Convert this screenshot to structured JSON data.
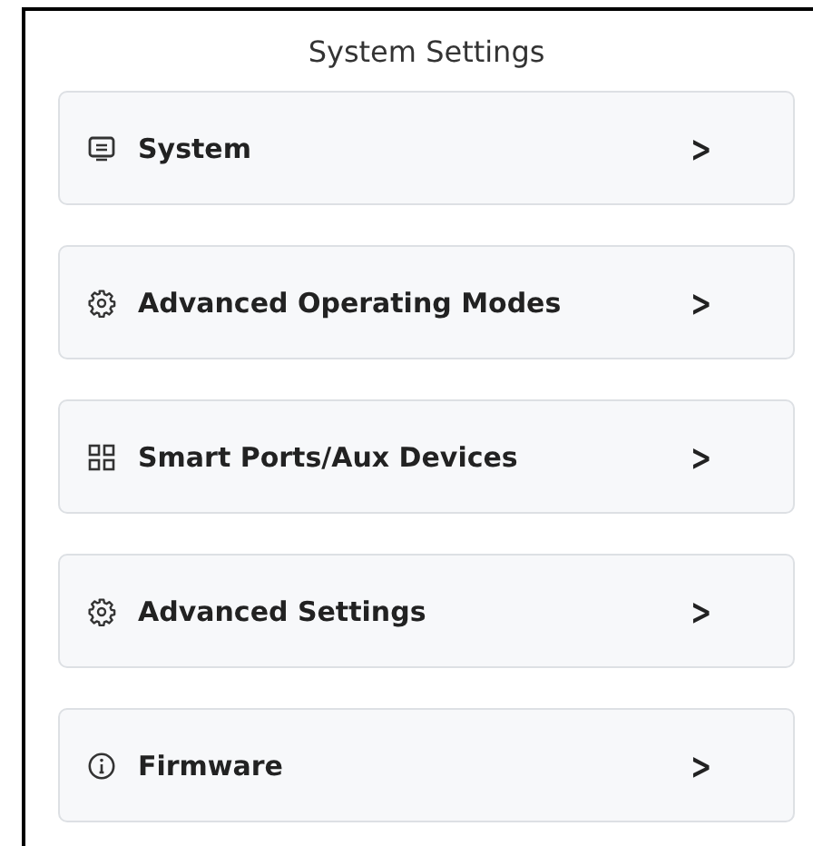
{
  "title": "System Settings",
  "items": [
    {
      "kind": "monitor",
      "label": "System",
      "chevron": ">"
    },
    {
      "kind": "gear",
      "label": "Advanced Operating Modes",
      "chevron": ">"
    },
    {
      "kind": "grid",
      "label": "Smart Ports/Aux Devices",
      "chevron": ">"
    },
    {
      "kind": "gear",
      "label": "Advanced Settings",
      "chevron": ">"
    },
    {
      "kind": "info",
      "label": "Firmware",
      "chevron": ">"
    }
  ]
}
